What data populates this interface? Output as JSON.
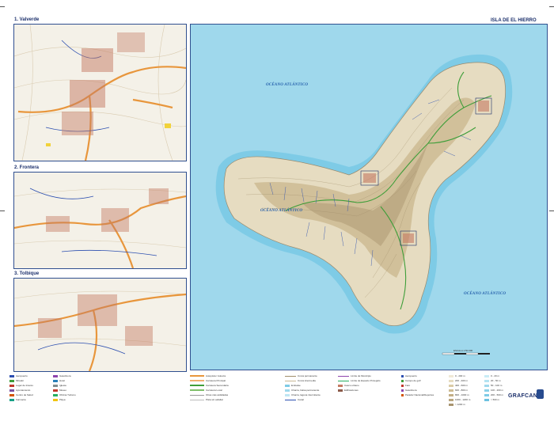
{
  "map": {
    "main_title": "ISLA DE EL HIERRO",
    "ocean_north": "OCÉANO ATLÁNTICO",
    "ocean_west": "OCÉANO ATLÁNTICO",
    "ocean_south": "OCÉANO ATLÁNTICO",
    "scale_label": "ESCALA 1:50.000",
    "publisher": "GRAFCAN",
    "colors": {
      "sea": "#9fd8ec",
      "sea_deep": "#6cc1e0",
      "land_low": "#e6dcc1",
      "land_high": "#b9a57f",
      "road_main": "#e8963c",
      "road_green": "#3f9e3a",
      "road_blue": "#2c4fb0",
      "frame": "#2f4f8f"
    }
  },
  "insets": [
    {
      "title": "1. Valverde"
    },
    {
      "title": "2. Frontera"
    },
    {
      "title": "3. Tolbique"
    }
  ],
  "legend": {
    "pois": [
      "Aeropuerto",
      "Mirador",
      "Lugar de Interés",
      "Ayuntamiento",
      "Centro de Salud",
      "Farmacia",
      "Gasolinera",
      "Hotel",
      "Iglesia",
      "Museo",
      "Oficina Turismo",
      "Playa"
    ],
    "routes": [
      "Autopista / Autovía",
      "Carretera Principal",
      "Carretera Secundaria",
      "Carretera Local",
      "Otras vías asfaltadas",
      "Pista sin asfaltar",
      "Vía Internacional"
    ],
    "hydro": [
      "Curva permanente",
      "Curva intermedia",
      "Embalse",
      "Charca, balsa permanente",
      "Charca, laguna intermitente",
      "Canal",
      "Tuberías"
    ],
    "admin": [
      "Límite de Municipio",
      "Límite de Espacio Protegido",
      "Casco urbano",
      "Edificaciones"
    ],
    "places": [
      "Aeropuerto",
      "Campo de golf",
      "Faro",
      "Gasolinera",
      "Parador Nacional/Deportes"
    ],
    "altitude": [
      "0 - 200 m",
      "200 - 400 m",
      "400 - 600 m",
      "600 - 800 m",
      "800 - 1000 m",
      "1000 - 1200 m",
      "> 1200 m"
    ],
    "depth": [
      "0 - 20 m",
      "20 - 50 m",
      "50 - 100 m",
      "100 - 200 m",
      "200 - 500 m",
      "> 500 m"
    ]
  }
}
